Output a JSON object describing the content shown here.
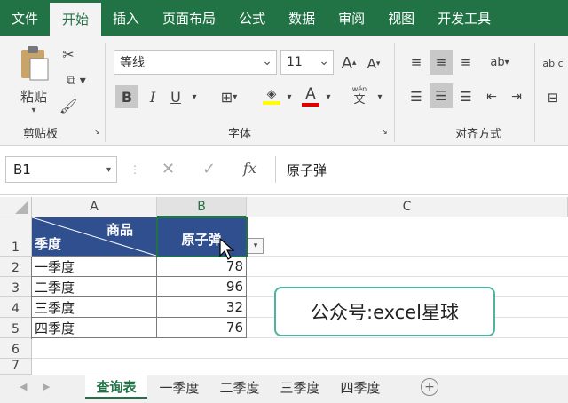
{
  "menu": {
    "tabs": [
      "文件",
      "开始",
      "插入",
      "页面布局",
      "公式",
      "数据",
      "审阅",
      "视图",
      "开发工具"
    ],
    "active": "开始"
  },
  "ribbon": {
    "clipboard": {
      "paste_label": "粘贴",
      "group_label": "剪贴板"
    },
    "font": {
      "font_name": "等线",
      "font_size": "11",
      "group_label": "字体",
      "bold": "B",
      "italic": "I",
      "underline": "U",
      "font_color_glyph": "A",
      "grow_glyph": "A",
      "shrink_glyph": "A",
      "phonetic_top": "wén",
      "phonetic_bottom": "文"
    },
    "alignment": {
      "group_label": "对齐方式",
      "wrap_label": "ab c"
    }
  },
  "formula_bar": {
    "name_box": "B1",
    "fx_label": "fx",
    "value": "原子弹"
  },
  "grid": {
    "columns": [
      "A",
      "B",
      "C"
    ],
    "rows": [
      "1",
      "2",
      "3",
      "4",
      "5",
      "6",
      "7"
    ],
    "header_top_right": "商品",
    "header_bottom_left": "季度",
    "b1": "原子弹",
    "data": [
      {
        "quarter": "一季度",
        "value": "78"
      },
      {
        "quarter": "二季度",
        "value": "96"
      },
      {
        "quarter": "三季度",
        "value": "32"
      },
      {
        "quarter": "四季度",
        "value": "76"
      }
    ]
  },
  "watermark": "公众号:excel星球",
  "sheets": {
    "tabs": [
      "查询表",
      "一季度",
      "二季度",
      "三季度",
      "四季度"
    ],
    "active": "查询表",
    "add_glyph": "+"
  },
  "colors": {
    "brand": "#217346",
    "header_fill": "#2f4f8f",
    "watermark_border": "#4fb3a0"
  }
}
